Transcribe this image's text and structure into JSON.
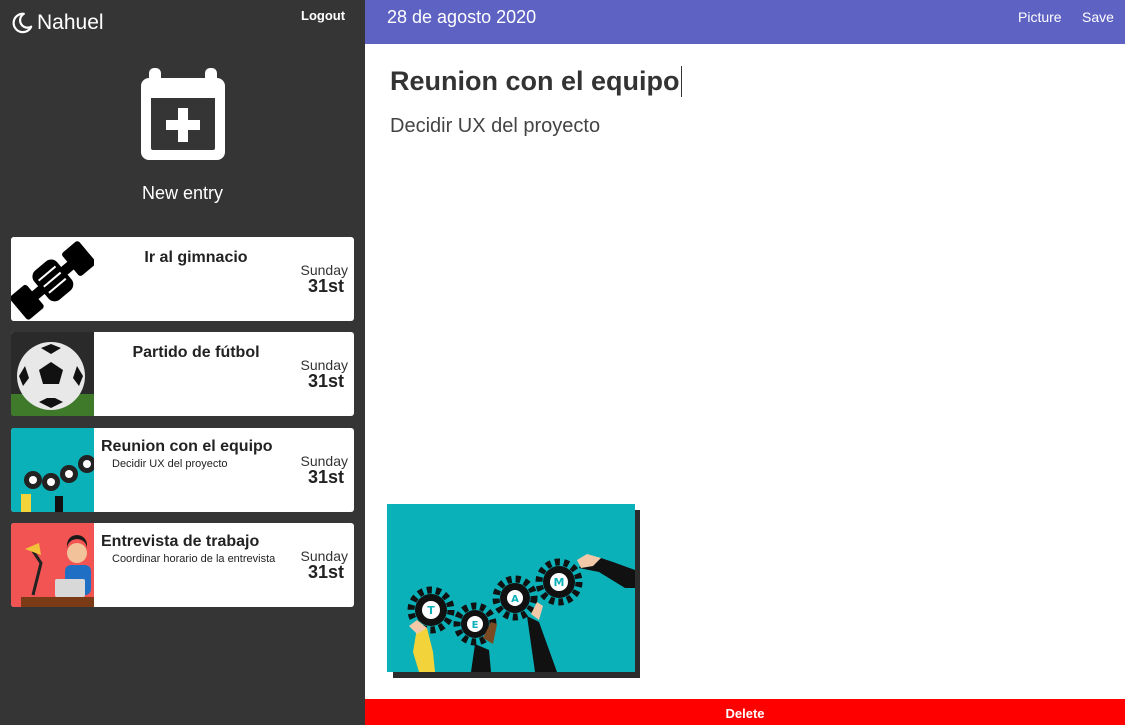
{
  "user": {
    "name": "Nahuel",
    "logout_label": "Logout"
  },
  "sidebar": {
    "new_entry_label": "New entry",
    "entries": [
      {
        "title": "Ir al gimnacio",
        "subtitle": "",
        "day_name": "Sunday",
        "day_num": "31st",
        "thumbnail": "dumbbell-icon"
      },
      {
        "title": "Partido de fútbol",
        "subtitle": "",
        "day_name": "Sunday",
        "day_num": "31st",
        "thumbnail": "soccer-ball-image"
      },
      {
        "title": "Reunion con el equipo",
        "subtitle": "Decidir UX del proyecto",
        "day_name": "Sunday",
        "day_num": "31st",
        "thumbnail": "team-gears-image"
      },
      {
        "title": "Entrevista de trabajo",
        "subtitle": "Coordinar horario de la entrevista",
        "day_name": "Sunday",
        "day_num": "31st",
        "thumbnail": "job-interview-image"
      }
    ]
  },
  "header": {
    "date": "28 de agosto 2020",
    "picture_label": "Picture",
    "save_label": "Save"
  },
  "editor": {
    "title": "Reunion con el equipo",
    "body": "Decidir UX del proyecto",
    "image": "team-gears-image",
    "image_letters": [
      "T",
      "E",
      "A",
      "M"
    ]
  },
  "footer": {
    "delete_label": "Delete"
  },
  "colors": {
    "sidebar_bg": "#353535",
    "topbar_bg": "#5e62c3",
    "delete_bg": "#ff0000",
    "team_image_bg": "#0bb1b8"
  }
}
